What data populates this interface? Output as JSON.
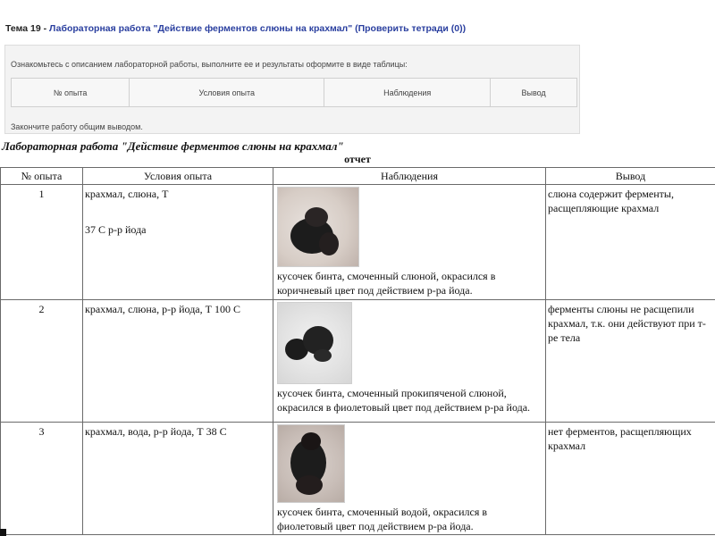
{
  "header": {
    "topic_prefix": "Тема 19 -",
    "lab_link": "Лабораторная работа \"Действие ферментов слюны на крахмал\"",
    "check_link": "(Проверить тетради (0))"
  },
  "assignment": {
    "intro": "Ознакомьтесь с описанием лабораторной работы, выполните ее и результаты оформите в виде таблицы:",
    "columns": [
      "№ опыта",
      "Условия опыта",
      "Наблюдения",
      "Вывод"
    ],
    "footer": "Закончите работу общим выводом."
  },
  "report": {
    "title": "Лабораторная работа \"Действие ферментов слюны на крахмал\"",
    "subtitle": "отчет",
    "columns": [
      "№ опыта",
      "Условия опыта",
      "Наблюдения",
      "Вывод"
    ],
    "rows": [
      {
        "num": "1",
        "conditions_line1": "крахмал, слюна, Т",
        "conditions_line2": "37 С р-р йода",
        "observation": "кусочек бинта, смоченный слюной, окрасился в коричневый цвет под действием р-ра йода.",
        "conclusion": "слюна содержит ферменты, расщепляющие крахмал"
      },
      {
        "num": "2",
        "conditions_line1": "крахмал, слюна, р-р йода, Т 100 С",
        "observation": "кусочек бинта, смоченный прокипяченой слюной, окрасился в фиолетовый цвет под действием р-ра йода.",
        "conclusion": "ферменты слюны не расщепили крахмал, т.к. они действуют при т-ре тела"
      },
      {
        "num": "3",
        "conditions_line1": "крахмал, вода, р-р йода, Т 38 С",
        "observation": "кусочек бинта, смоченный водой, окрасился в фиолетовый цвет под действием р-ра йода.",
        "conclusion": "нет ферментов, расщепляющих крахмал"
      }
    ]
  },
  "colors": {
    "link": "#2a3f9f",
    "panel_bg": "#f3f3f3",
    "table_border": "#6a6a6a"
  }
}
